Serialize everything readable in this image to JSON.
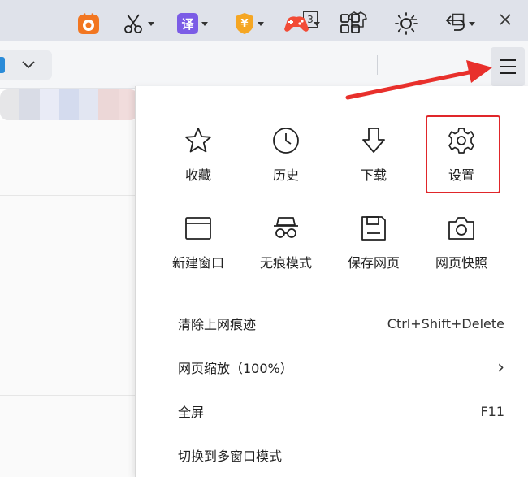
{
  "window": {
    "badge_text": "3"
  },
  "toolbar": {
    "translate_label": "译",
    "coin_label": "¥"
  },
  "menu": {
    "grid": [
      {
        "label": "收藏",
        "icon": "star-icon"
      },
      {
        "label": "历史",
        "icon": "clock-icon"
      },
      {
        "label": "下载",
        "icon": "download-arrow-icon"
      },
      {
        "label": "设置",
        "icon": "gear-icon"
      },
      {
        "label": "新建窗口",
        "icon": "new-window-icon"
      },
      {
        "label": "无痕模式",
        "icon": "incognito-icon"
      },
      {
        "label": "保存网页",
        "icon": "save-icon"
      },
      {
        "label": "网页快照",
        "icon": "camera-icon"
      }
    ],
    "rows": [
      {
        "label": "清除上网痕迹",
        "shortcut": "Ctrl+Shift+Delete"
      },
      {
        "label": "网页缩放（100%）",
        "shortcut": "›"
      },
      {
        "label": "全屏",
        "shortcut": "F11"
      },
      {
        "label": "切换到多窗口模式",
        "shortcut": ""
      }
    ]
  },
  "colors": {
    "highlight": "#e0262a",
    "arrow": "#e8302c",
    "titlebar": "#dfe2ea",
    "toolbar": "#f5f6f8"
  }
}
